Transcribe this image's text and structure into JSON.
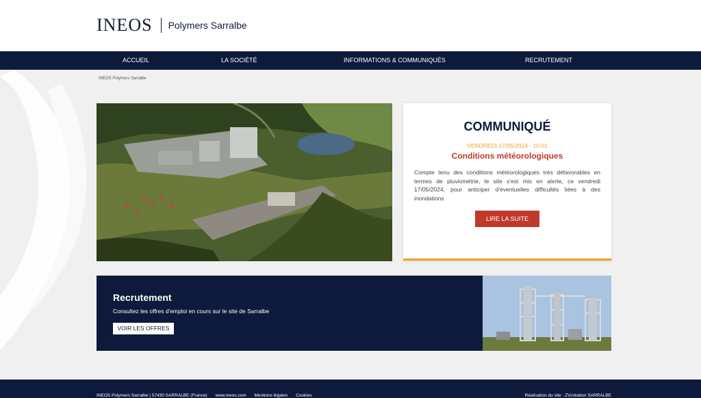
{
  "header": {
    "logo_text": "INEOS",
    "site_name": "Polymers Sarralbe"
  },
  "nav": {
    "items": [
      {
        "label": "ACCUEIL"
      },
      {
        "label": "LA SOCIÉTÉ"
      },
      {
        "label": "INFORMATIONS & COMMUNIQUÉS"
      },
      {
        "label": "RECRUTEMENT"
      }
    ]
  },
  "breadcrumb": "INEOS Polymers Sarralbe",
  "communique": {
    "title": "COMMUNIQUÉ",
    "date": "VENDREDI 17/05/2024 - 10:01",
    "headline": "Conditions météorologiques",
    "body": "Compte tenu des conditions météorologiques très défavorables en termes de pluviométrie, le site s'est mis en alerte, ce vendredi 17/05/2024, pour anticiper d'éventuelles difficultés liées à des inondations",
    "button_label": "LIRE LA SUITE"
  },
  "recruitment": {
    "title": "Recrutement",
    "description": "Consultez les offres d'emploi en cours sur le site de Sarralbe",
    "button_label": "VOIR LES OFFRES"
  },
  "footer": {
    "address": "INEOS Polymers Sarralbe | 57430 SARRALBE (France)",
    "website": "www.ineos.com",
    "legal": "Mentions légales",
    "cookies": "Cookies",
    "credit": "Réalisation du site : ZVcréation SARRALBE"
  },
  "colors": {
    "navy": "#0e1a3c",
    "accent_orange": "#f0a030",
    "accent_red": "#c0392b"
  }
}
